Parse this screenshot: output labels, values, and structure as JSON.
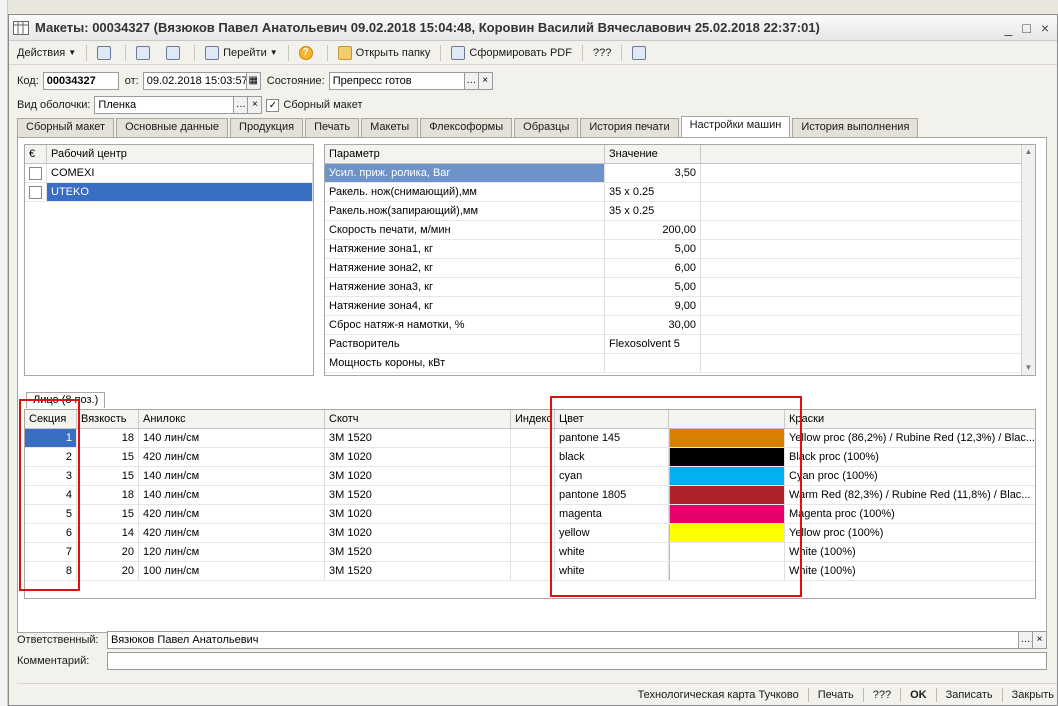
{
  "window": {
    "title": "Макеты: 00034327 (Вязюков Павел Анатольевич 09.02.2018 15:04:48, Коровин Василий Вячеславович 25.02.2018 22:37:01)",
    "controls": [
      "_",
      "□",
      "×"
    ]
  },
  "toolbar": {
    "actions": "Действия",
    "goto": "Перейти",
    "help": "?",
    "open_folder": "Открыть папку",
    "make_pdf": "Сформировать PDF",
    "qqq": "???"
  },
  "header": {
    "code_label": "Код:",
    "code": "00034327",
    "from_label": "от:",
    "date": "09.02.2018 15:03:57",
    "state_label": "Состояние:",
    "state": "Препресс готов",
    "shell_label": "Вид оболочки:",
    "shell": "Пленка",
    "assembled_label": "Сборный макет",
    "assembled_checked": true
  },
  "tabs": [
    "Сборный макет",
    "Основные данные",
    "Продукция",
    "Печать",
    "Макеты",
    "Флексоформы",
    "Образцы",
    "История печати",
    "Настройки машин",
    "История выполнения"
  ],
  "active_tab": 8,
  "workcenters": {
    "header_icon": "€",
    "header": "Рабочий центр",
    "rows": [
      "COMEXI",
      "UTEKO"
    ],
    "selected": 1
  },
  "params": {
    "col_param": "Параметр",
    "col_value": "Значение",
    "rows": [
      {
        "name": "Усил. приж. ролика, Bar",
        "value": "3,50",
        "num": true
      },
      {
        "name": "Ракель. нож(снимающий),мм",
        "value": "35 x 0.25",
        "num": false
      },
      {
        "name": "Ракель.нож(запирающий),мм",
        "value": "35 x 0.25",
        "num": false
      },
      {
        "name": "Скорость печати, м/мин",
        "value": "200,00",
        "num": true
      },
      {
        "name": "Натяжение зона1, кг",
        "value": "5,00",
        "num": true
      },
      {
        "name": "Натяжение зона2, кг",
        "value": "6,00",
        "num": true
      },
      {
        "name": "Натяжение зона3, кг",
        "value": "5,00",
        "num": true
      },
      {
        "name": "Натяжение зона4, кг",
        "value": "9,00",
        "num": true
      },
      {
        "name": "Сброс натяж-я намотки, %",
        "value": "30,00",
        "num": true
      },
      {
        "name": "Растворитель",
        "value": "Flexosolvent 5",
        "num": false
      },
      {
        "name": "Мощность короны, кВт",
        "value": "",
        "num": false
      }
    ]
  },
  "sections_tab": "Лицо (8 поз.)",
  "sections": {
    "headers": {
      "section": "Секция",
      "viscosity": "Вязкость",
      "anilox": "Анилокс",
      "tape": "Скотч",
      "index": "Индекс",
      "color": "Цвет",
      "swatch": "",
      "inks": "Краски"
    },
    "rows": [
      {
        "section": "1",
        "viscosity": "18",
        "anilox": "140 лин/см",
        "tape": "3M 1520",
        "index": "",
        "color": "pantone 145",
        "swatch": "#d97f00",
        "inks": "Yellow proc (86,2%) / Rubine Red (12,3%) / Blac..."
      },
      {
        "section": "2",
        "viscosity": "15",
        "anilox": "420 лин/см",
        "tape": "3M 1020",
        "index": "",
        "color": "black",
        "swatch": "#000000",
        "inks": "Black proc (100%)"
      },
      {
        "section": "3",
        "viscosity": "15",
        "anilox": "140 лин/см",
        "tape": "3M 1020",
        "index": "",
        "color": "cyan",
        "swatch": "#00b0f0",
        "inks": "Cyan proc (100%)"
      },
      {
        "section": "4",
        "viscosity": "18",
        "anilox": "140 лин/см",
        "tape": "3M 1520",
        "index": "",
        "color": "pantone 1805",
        "swatch": "#b0222a",
        "inks": "Warm Red (82,3%) / Rubine Red (11,8%) / Blac..."
      },
      {
        "section": "5",
        "viscosity": "15",
        "anilox": "420 лин/см",
        "tape": "3M 1020",
        "index": "",
        "color": "magenta",
        "swatch": "#e8006a",
        "inks": "Magenta proc (100%)"
      },
      {
        "section": "6",
        "viscosity": "14",
        "anilox": "420 лин/см",
        "tape": "3M 1020",
        "index": "",
        "color": "yellow",
        "swatch": "#ffff00",
        "inks": "Yellow proc (100%)"
      },
      {
        "section": "7",
        "viscosity": "20",
        "anilox": "120 лин/см",
        "tape": "3M 1520",
        "index": "",
        "color": "white",
        "swatch": "#ffffff",
        "inks": "White (100%)"
      },
      {
        "section": "8",
        "viscosity": "20",
        "anilox": "100 лин/см",
        "tape": "3M 1520",
        "index": "",
        "color": "white",
        "swatch": "#ffffff",
        "inks": "White (100%)"
      }
    ]
  },
  "footer": {
    "responsible_label": "Ответственный:",
    "responsible": "Вязюков Павел Анатольевич",
    "comment_label": "Комментарий:",
    "comment": ""
  },
  "bottom": {
    "techcard": "Технологическая карта Тучково",
    "print": "Печать",
    "qqq": "???",
    "ok": "OK",
    "save": "Записать",
    "close": "Закрыть"
  }
}
